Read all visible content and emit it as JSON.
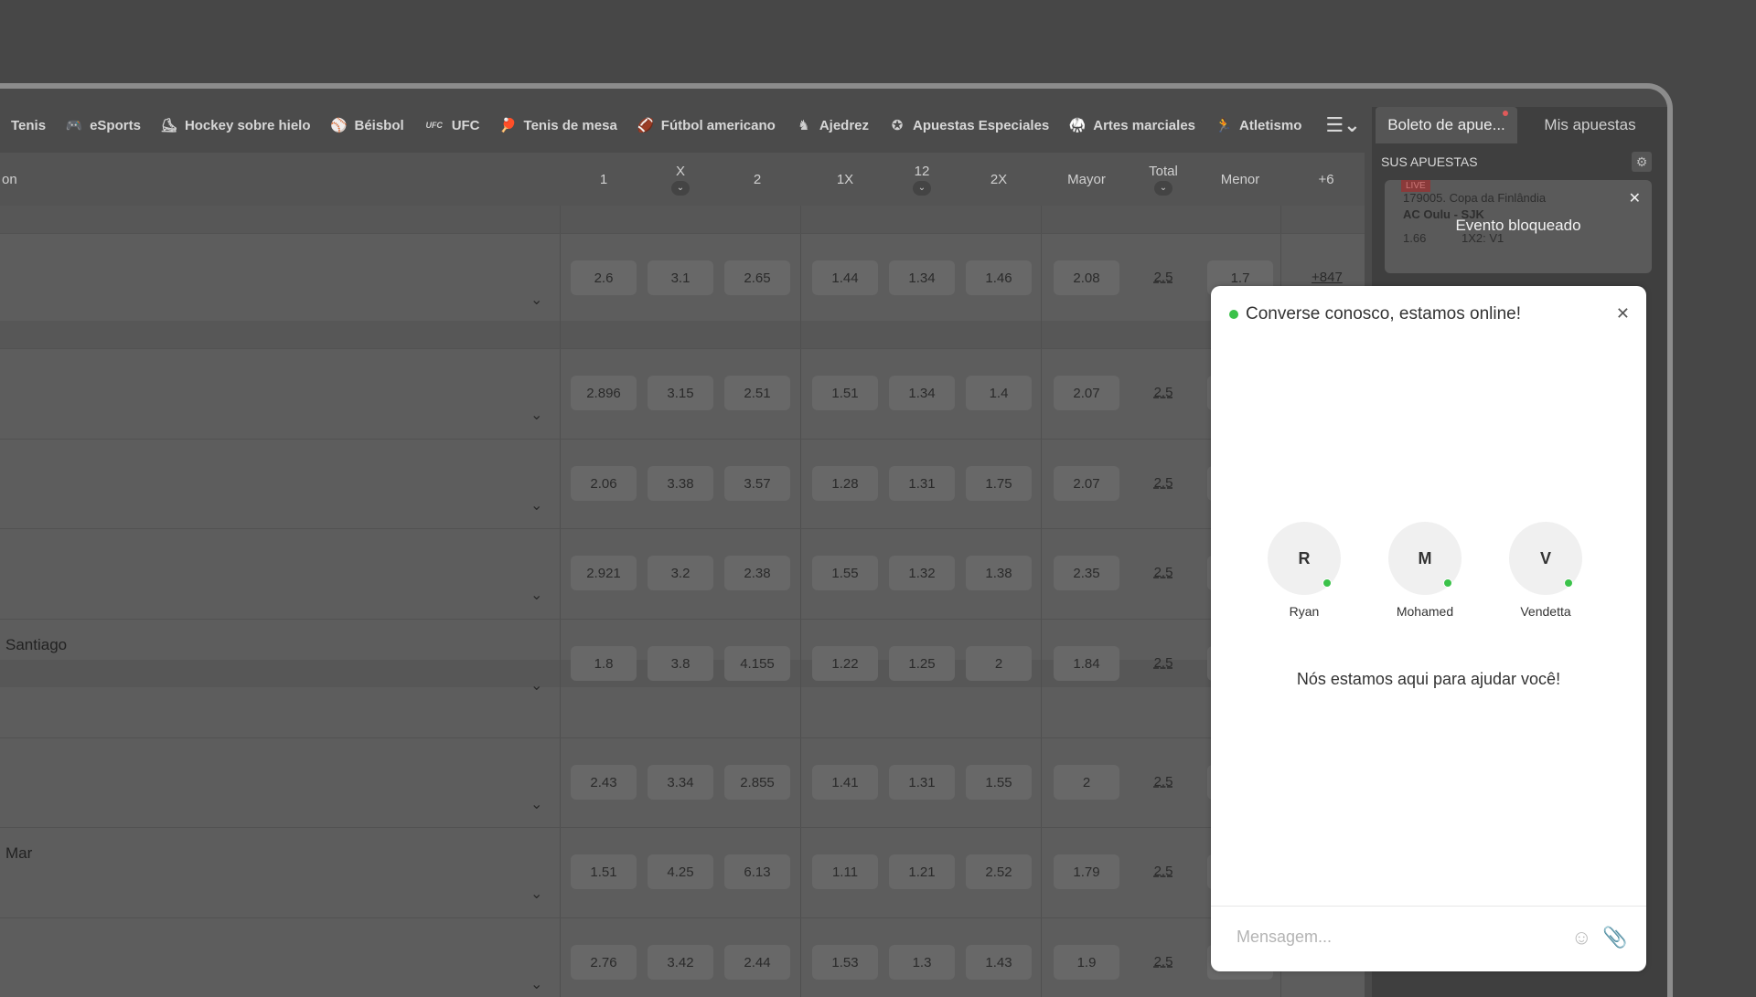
{
  "sports": [
    {
      "icon": "tennis-icon",
      "glyph": "",
      "label": "Tenis"
    },
    {
      "icon": "gamepad-icon",
      "glyph": "🎮",
      "label": "eSports"
    },
    {
      "icon": "hockey-icon",
      "glyph": "⛸",
      "label": "Hockey sobre hielo"
    },
    {
      "icon": "baseball-icon",
      "glyph": "⚾",
      "label": "Béisbol"
    },
    {
      "icon": "ufc-icon",
      "glyph": "UFC",
      "label": "UFC"
    },
    {
      "icon": "table-tennis-icon",
      "glyph": "🏓",
      "label": "Tenis de mesa"
    },
    {
      "icon": "american-football-icon",
      "glyph": "🏈",
      "label": "Fútbol americano"
    },
    {
      "icon": "chess-icon",
      "glyph": "♞",
      "label": "Ajedrez"
    },
    {
      "icon": "star-icon",
      "glyph": "✪",
      "label": "Apuestas Especiales"
    },
    {
      "icon": "martial-arts-icon",
      "glyph": "🥋",
      "label": "Artes marciales"
    },
    {
      "icon": "athletics-icon",
      "glyph": "🏃",
      "label": "Atletismo"
    }
  ],
  "header": {
    "event_col": "on",
    "cols": [
      "1",
      "X",
      "2",
      "1X",
      "12",
      "2X",
      "Mayor",
      "Total",
      "Menor",
      "+6"
    ]
  },
  "rows": [
    {
      "name": "",
      "odds": [
        "2.6",
        "3.1",
        "2.65",
        "1.44",
        "1.34",
        "1.46",
        "2.08"
      ],
      "total": "2.5",
      "menor": "1.7",
      "more": "+847"
    },
    {
      "name": "",
      "odds": [
        "2.896",
        "3.15",
        "2.51",
        "1.51",
        "1.34",
        "1.4",
        "2.07"
      ],
      "total": "2.5",
      "menor": "",
      "more": ""
    },
    {
      "name": "",
      "odds": [
        "2.06",
        "3.38",
        "3.57",
        "1.28",
        "1.31",
        "1.75",
        "2.07"
      ],
      "total": "2.5",
      "menor": "",
      "more": ""
    },
    {
      "name": "",
      "odds": [
        "2.921",
        "3.2",
        "2.38",
        "1.55",
        "1.32",
        "1.38",
        "2.35"
      ],
      "total": "2.5",
      "menor": "",
      "more": ""
    },
    {
      "name": "Santiago",
      "odds": [
        "1.8",
        "3.8",
        "4.155",
        "1.22",
        "1.25",
        "2",
        "1.84"
      ],
      "total": "2.5",
      "menor": "",
      "more": ""
    },
    {
      "name": "",
      "odds": [
        "2.43",
        "3.34",
        "2.855",
        "1.41",
        "1.31",
        "1.55",
        "2"
      ],
      "total": "2.5",
      "menor": "",
      "more": ""
    },
    {
      "name": "Mar",
      "odds": [
        "1.51",
        "4.25",
        "6.13",
        "1.11",
        "1.21",
        "2.52",
        "1.79"
      ],
      "total": "2.5",
      "menor": "",
      "more": ""
    },
    {
      "name": "",
      "odds": [
        "2.76",
        "3.42",
        "2.44",
        "1.53",
        "1.3",
        "1.43",
        "1.9"
      ],
      "total": "2.5",
      "menor": "",
      "more": ""
    }
  ],
  "betslip": {
    "tab_active": "Boleto de apue...",
    "tab_other": "Mis apuestas",
    "section": "SUS APUESTAS",
    "live": "LIVE",
    "event": "179005. Copa da Finlândia",
    "teams": "AC Oulu - SJK",
    "odd": "1.66",
    "market": "1X2: V1",
    "blocked": "Evento bloqueado"
  },
  "chat": {
    "title": "Converse conosco, estamos online!",
    "agents": [
      {
        "initial": "R",
        "name": "Ryan"
      },
      {
        "initial": "M",
        "name": "Mohamed"
      },
      {
        "initial": "V",
        "name": "Vendetta"
      }
    ],
    "help": "Nós estamos aqui para ajudar você!",
    "placeholder": "Mensagem..."
  },
  "colors": {
    "online": "#3bc24a",
    "notice_dot": "#e05a5a"
  }
}
